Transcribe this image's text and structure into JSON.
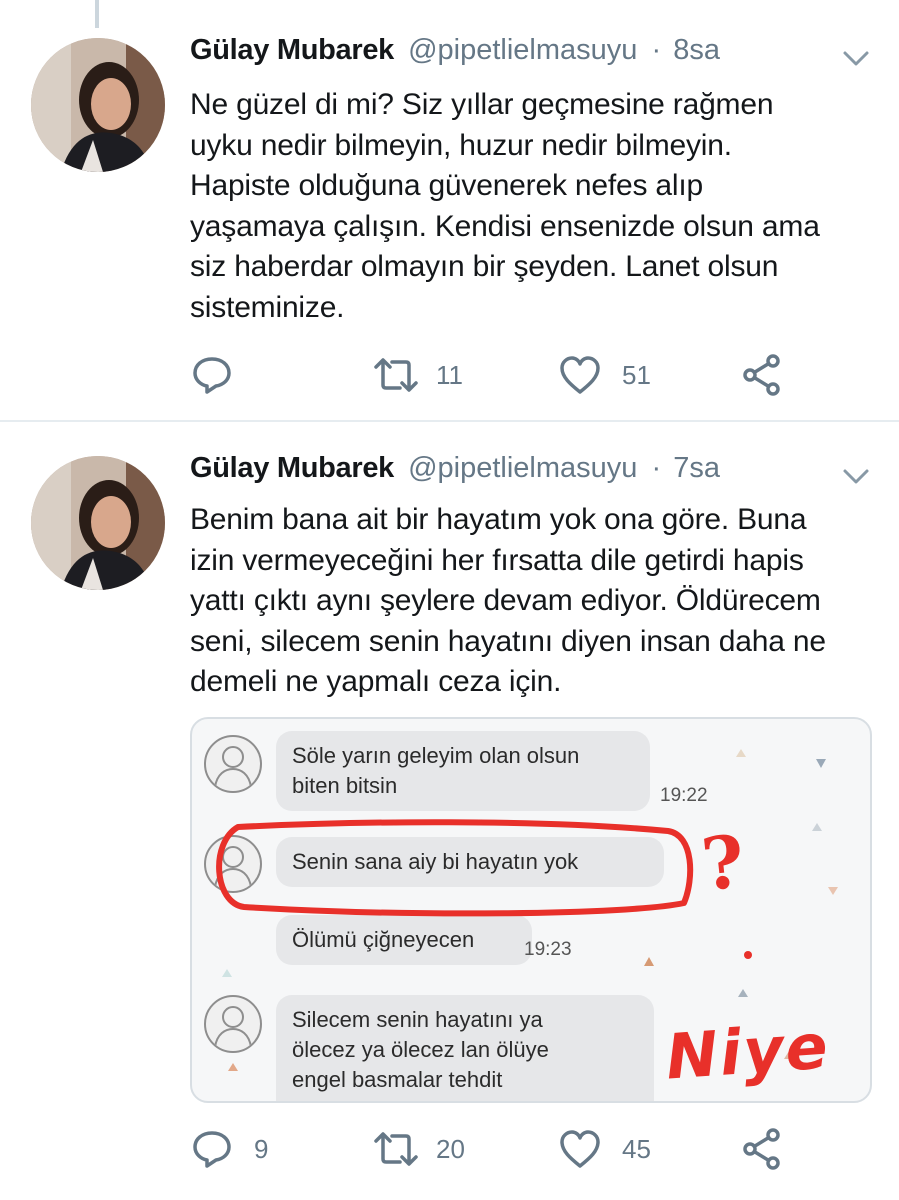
{
  "tweets": [
    {
      "name": "Gülay Mubarek",
      "handle": "@pipetlielmasuyu",
      "time": "8sa",
      "separator": "·",
      "text": "Ne güzel di mi? Siz yıllar geçmesine rağmen\nuyku nedir bilmeyin, huzur nedir bilmeyin.\nHapiste olduğuna  güvenerek nefes alıp\nyaşamaya çalışın. Kendisi ensenizde olsun ama\nsiz haberdar olmayın bir şeyden. Lanet olsun\nsisteminize.",
      "actions": {
        "replies": "",
        "retweets": "11",
        "likes": "51"
      }
    },
    {
      "name": "Gülay Mubarek",
      "handle": "@pipetlielmasuyu",
      "time": "7sa",
      "separator": "·",
      "text": "Benim bana ait bir hayatım yok ona göre. Buna\nizin vermeyeceğini her fırsatta dile getirdi hapis\nyattı çıktı  aynı şeylere devam ediyor.  Öldürecem\nseni, silecem senin hayatını diyen insan daha ne\ndemeli ne yapmalı ceza için.",
      "actions": {
        "replies": "9",
        "retweets": "20",
        "likes": "45"
      }
    }
  ],
  "screenshot": {
    "messages": [
      {
        "text": "Söle yarın geleyim olan olsun\nbiten bitsin",
        "time": "19:22"
      },
      {
        "text": "Senin sana aiy bi hayatın yok",
        "time": ""
      },
      {
        "text": "Ölümü çiğneyecen",
        "time": "19:23"
      },
      {
        "text": "Silecem senin hayatını ya\nölecez ya ölecez lan ölüye\nengel basmalar tehdit",
        "time": ""
      }
    ],
    "annotations": {
      "question_mark": "?",
      "handwritten": "Niye"
    },
    "colors": {
      "bubble": "#e6e7e9",
      "annotation": "#e8302a"
    }
  },
  "colors": {
    "handle": "#657786",
    "text": "#14171a",
    "divider": "#e6ecf0"
  },
  "icons": [
    "reply-icon",
    "retweet-icon",
    "like-icon",
    "share-icon",
    "chevron-down-icon"
  ]
}
